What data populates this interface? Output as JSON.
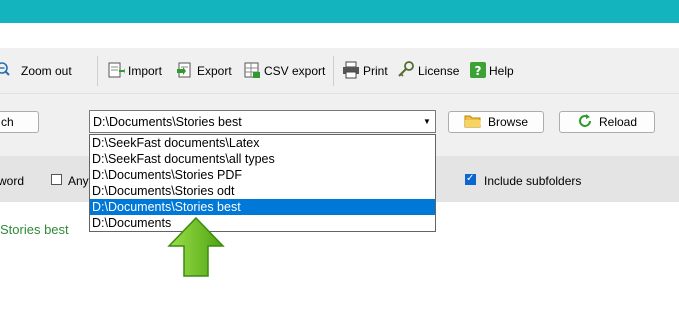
{
  "toolbar": {
    "zoom_out": "Zoom out",
    "import": "Import",
    "export": "Export",
    "csv_export": "CSV export",
    "print": "Print",
    "license": "License",
    "help": "Help"
  },
  "row2": {
    "search_button_partial": "ch",
    "folder_value": "D:\\Documents\\Stories best",
    "browse": "Browse",
    "reload": "Reload"
  },
  "row3": {
    "whole_word_partial": "word",
    "any_partial": "Any",
    "include_subfolders": "Include subfolders"
  },
  "dropdown": {
    "items": [
      "D:\\SeekFast documents\\Latex",
      "D:\\SeekFast documents\\all types",
      "D:\\Documents\\Stories PDF",
      "D:\\Documents\\Stories odt",
      "D:\\Documents\\Stories best",
      "D:\\Documents"
    ],
    "selected_index": 4
  },
  "results": {
    "folder_label": "Stories best"
  },
  "colors": {
    "titlebar": "#14b4be",
    "selection": "#0078d7",
    "arrow": "#6cc21c",
    "green_text": "#2e8b3a"
  }
}
